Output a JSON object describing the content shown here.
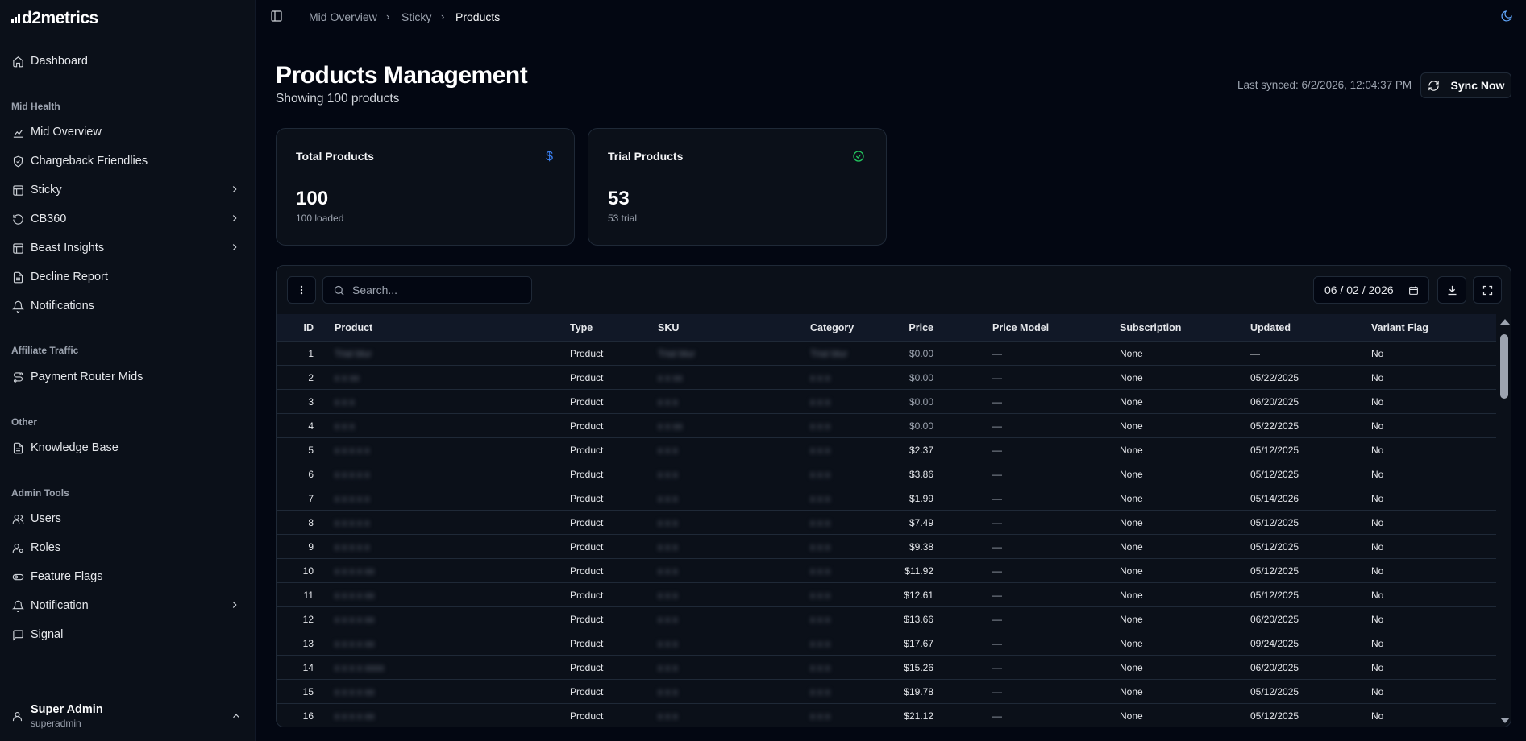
{
  "app": {
    "logo_text": "d2metrics"
  },
  "sidebar": {
    "dashboard": "Dashboard",
    "sections": {
      "mid_health": "Mid Health",
      "affiliate_traffic": "Affiliate Traffic",
      "other": "Other",
      "admin_tools": "Admin Tools"
    },
    "mid_health_items": [
      {
        "label": "Mid Overview",
        "icon": "chart-line-icon"
      },
      {
        "label": "Chargeback Friendlies",
        "icon": "shield-icon"
      },
      {
        "label": "Sticky",
        "icon": "table-icon"
      },
      {
        "label": "CB360",
        "icon": "refresh-icon"
      },
      {
        "label": "Beast Insights",
        "icon": "table-icon"
      },
      {
        "label": "Decline Report",
        "icon": "file-text-icon"
      },
      {
        "label": "Notifications",
        "icon": "bell-icon"
      }
    ],
    "affiliate_items": [
      {
        "label": "Payment Router Mids",
        "icon": "route-icon"
      }
    ],
    "other_items": [
      {
        "label": "Knowledge Base",
        "icon": "file-text-icon"
      }
    ],
    "admin_items": [
      {
        "label": "Users",
        "icon": "users-icon"
      },
      {
        "label": "Roles",
        "icon": "user-cog-icon"
      },
      {
        "label": "Feature Flags",
        "icon": "toggle-icon"
      },
      {
        "label": "Notification",
        "icon": "bell-icon"
      },
      {
        "label": "Signal",
        "icon": "message-icon"
      }
    ],
    "user": {
      "name": "Super Admin",
      "role": "superadmin"
    }
  },
  "breadcrumb": [
    "Mid Overview",
    "Sticky",
    "Products"
  ],
  "page": {
    "title": "Products Management",
    "subtitle": "Showing 100 products",
    "last_synced": "Last synced: 6/2/2026, 12:04:37 PM",
    "sync_label": "Sync Now"
  },
  "cards": [
    {
      "title": "Total Products",
      "value": "100",
      "sub": "100 loaded",
      "icon": "dollar-icon",
      "icon_color": "#3b82f6"
    },
    {
      "title": "Trial Products",
      "value": "53",
      "sub": "53 trial",
      "icon": "check-circle-icon",
      "icon_color": "#22c55e"
    }
  ],
  "toolbar": {
    "search_placeholder": "Search...",
    "date_value": "06 / 02 / 2026"
  },
  "table": {
    "columns": [
      "ID",
      "Product",
      "Type",
      "SKU",
      "Category",
      "Price",
      "Price Model",
      "Subscription",
      "Updated",
      "Variant Flag"
    ],
    "rows": [
      {
        "id": "1",
        "product": "Trial blur",
        "type": "Product",
        "sku": "Trial blur",
        "category": "Trial blur",
        "price": "$0.00",
        "price_model": "—",
        "subscription": "None",
        "updated": "—",
        "variant": "No"
      },
      {
        "id": "2",
        "product": "x x xx",
        "type": "Product",
        "sku": "x x xx",
        "category": "x x x",
        "price": "$0.00",
        "price_model": "—",
        "subscription": "None",
        "updated": "05/22/2025",
        "variant": "No"
      },
      {
        "id": "3",
        "product": "x x x",
        "type": "Product",
        "sku": "x x x",
        "category": "x x x",
        "price": "$0.00",
        "price_model": "—",
        "subscription": "None",
        "updated": "06/20/2025",
        "variant": "No"
      },
      {
        "id": "4",
        "product": "x x x",
        "type": "Product",
        "sku": "x x xx",
        "category": "x x x",
        "price": "$0.00",
        "price_model": "—",
        "subscription": "None",
        "updated": "05/22/2025",
        "variant": "No"
      },
      {
        "id": "5",
        "product": "x x x x x",
        "type": "Product",
        "sku": "x x x",
        "category": "x x x",
        "price": "$2.37",
        "price_model": "—",
        "subscription": "None",
        "updated": "05/12/2025",
        "variant": "No"
      },
      {
        "id": "6",
        "product": "x x x x x",
        "type": "Product",
        "sku": "x x x",
        "category": "x x x",
        "price": "$3.86",
        "price_model": "—",
        "subscription": "None",
        "updated": "05/12/2025",
        "variant": "No"
      },
      {
        "id": "7",
        "product": "x x x x x",
        "type": "Product",
        "sku": "x x x",
        "category": "x x x",
        "price": "$1.99",
        "price_model": "—",
        "subscription": "None",
        "updated": "05/14/2026",
        "variant": "No"
      },
      {
        "id": "8",
        "product": "x x x x x",
        "type": "Product",
        "sku": "x x x",
        "category": "x x x",
        "price": "$7.49",
        "price_model": "—",
        "subscription": "None",
        "updated": "05/12/2025",
        "variant": "No"
      },
      {
        "id": "9",
        "product": "x x x x x",
        "type": "Product",
        "sku": "x x x",
        "category": "x x x",
        "price": "$9.38",
        "price_model": "—",
        "subscription": "None",
        "updated": "05/12/2025",
        "variant": "No"
      },
      {
        "id": "10",
        "product": "x x x x xx",
        "type": "Product",
        "sku": "x x x",
        "category": "x x x",
        "price": "$11.92",
        "price_model": "—",
        "subscription": "None",
        "updated": "05/12/2025",
        "variant": "No"
      },
      {
        "id": "11",
        "product": "x x x x xx",
        "type": "Product",
        "sku": "x x x",
        "category": "x x x",
        "price": "$12.61",
        "price_model": "—",
        "subscription": "None",
        "updated": "05/12/2025",
        "variant": "No"
      },
      {
        "id": "12",
        "product": "x x x x xx",
        "type": "Product",
        "sku": "x x x",
        "category": "x x x",
        "price": "$13.66",
        "price_model": "—",
        "subscription": "None",
        "updated": "06/20/2025",
        "variant": "No"
      },
      {
        "id": "13",
        "product": "x x x x xx",
        "type": "Product",
        "sku": "x x x",
        "category": "x x x",
        "price": "$17.67",
        "price_model": "—",
        "subscription": "None",
        "updated": "09/24/2025",
        "variant": "No"
      },
      {
        "id": "14",
        "product": "x x x x xxxx",
        "type": "Product",
        "sku": "x x x",
        "category": "x x x",
        "price": "$15.26",
        "price_model": "—",
        "subscription": "None",
        "updated": "06/20/2025",
        "variant": "No"
      },
      {
        "id": "15",
        "product": "x x x x xx",
        "type": "Product",
        "sku": "x x x",
        "category": "x x x",
        "price": "$19.78",
        "price_model": "—",
        "subscription": "None",
        "updated": "05/12/2025",
        "variant": "No"
      },
      {
        "id": "16",
        "product": "x x x x xx",
        "type": "Product",
        "sku": "x x x",
        "category": "x x x",
        "price": "$21.12",
        "price_model": "—",
        "subscription": "None",
        "updated": "05/12/2025",
        "variant": "No"
      }
    ]
  }
}
